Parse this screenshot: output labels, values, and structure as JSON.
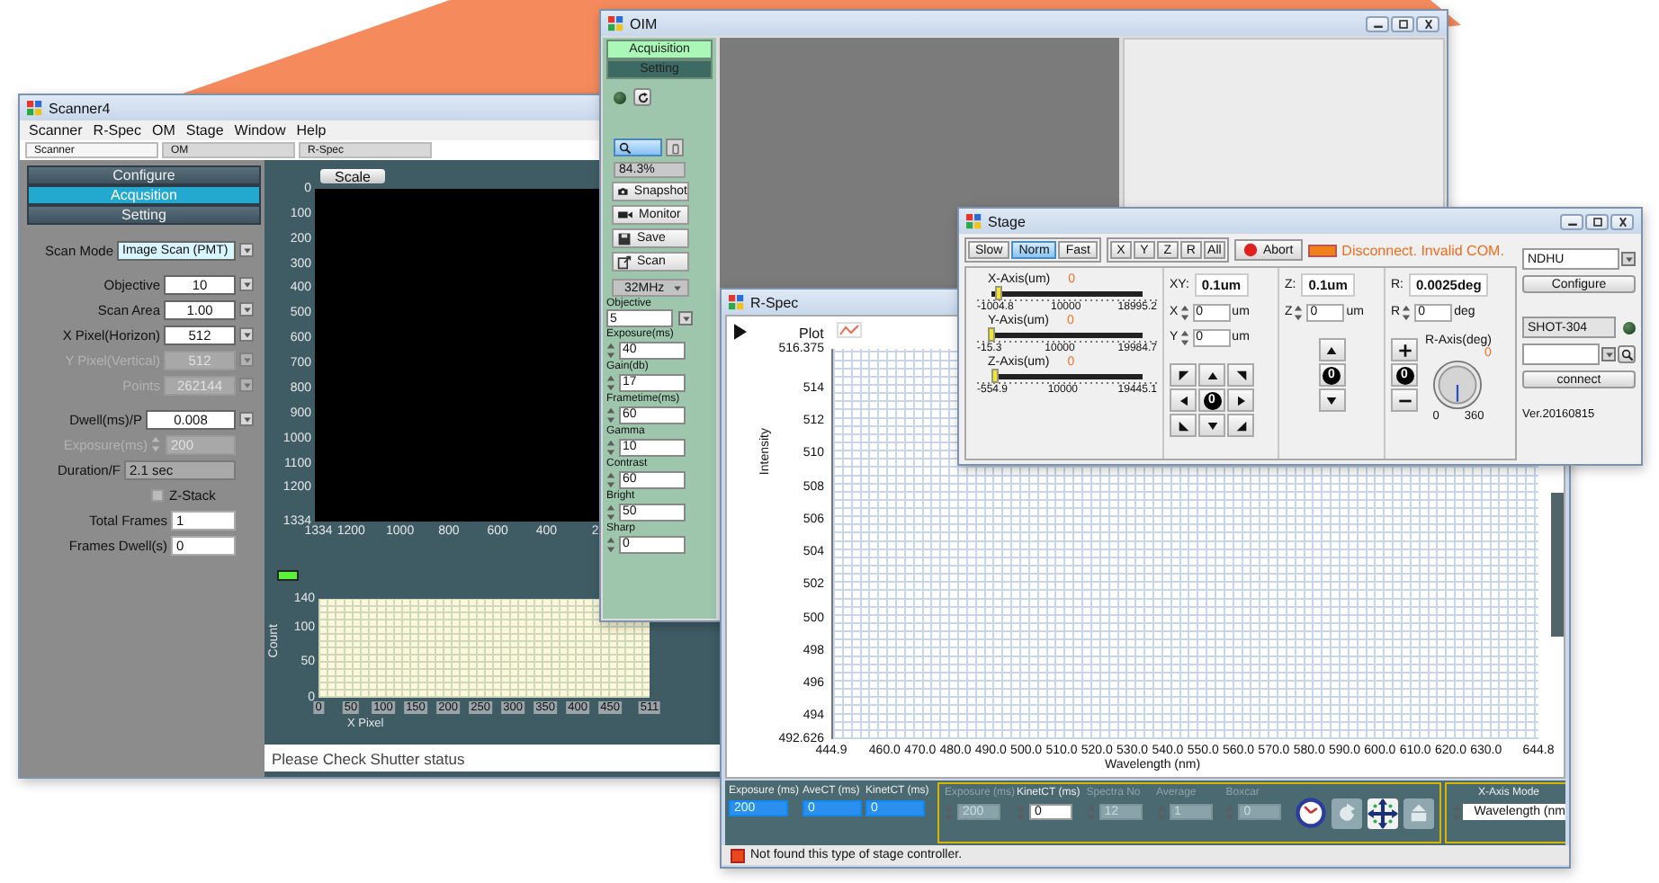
{
  "scanner": {
    "title": "Scanner4",
    "menu": [
      "Scanner",
      "R-Spec",
      "OM",
      "Stage",
      "Window",
      "Help"
    ],
    "tabs": [
      {
        "label": "Scanner",
        "selected": true
      },
      {
        "label": "OM",
        "selected": false
      },
      {
        "label": "R-Spec",
        "selected": false
      }
    ],
    "nav": [
      {
        "label": "Configure",
        "selected": false
      },
      {
        "label": "Acqusition",
        "selected": true
      },
      {
        "label": "Setting",
        "selected": false
      }
    ],
    "fields": [
      {
        "label": "Scan Mode",
        "value": "Image Scan (PMT)",
        "kind": "mode",
        "disabled": false
      },
      {
        "label": "Objective",
        "value": "10",
        "kind": "dropdown",
        "disabled": false
      },
      {
        "label": "Scan Area",
        "value": "1.00",
        "kind": "dropdown",
        "disabled": false
      },
      {
        "label": "X Pixel(Horizon)",
        "value": "512",
        "kind": "dropdown",
        "disabled": false
      },
      {
        "label": "Y Pixel(Vertical)",
        "value": "512",
        "kind": "dropdown",
        "disabled": true
      },
      {
        "label": "Points",
        "value": "262144",
        "kind": "dropdown",
        "disabled": true
      },
      {
        "label": "Dwell(ms)/P",
        "value": "0.008",
        "kind": "wide",
        "disabled": false
      },
      {
        "label": "Exposure(ms)",
        "value": "200",
        "kind": "spin",
        "disabled": true
      },
      {
        "label": "Duration/F",
        "value": "2.1 sec",
        "kind": "readout",
        "disabled": false
      }
    ],
    "z_stack": {
      "label": "Z-Stack",
      "checked": false
    },
    "frames": [
      {
        "label": "Total Frames",
        "value": "1"
      },
      {
        "label": "Frames Dwell(s)",
        "value": "0"
      }
    ],
    "scale_button": "Scale",
    "image": {
      "y_ticks": [
        "0",
        "100",
        "200",
        "300",
        "400",
        "500",
        "600",
        "700",
        "800",
        "900",
        "1000",
        "1100",
        "1200",
        "1334"
      ],
      "x_ticks": [
        "1334",
        "1200",
        "1000",
        "800",
        "600",
        "400",
        "2"
      ]
    },
    "led_on": true,
    "histogram": {
      "ylabel": "Count",
      "xlabel": "X Pixel",
      "y_ticks": [
        "140",
        "100",
        "50",
        "0"
      ],
      "x_ticks": [
        "0",
        "50",
        "100",
        "150",
        "200",
        "250",
        "300",
        "350",
        "400",
        "450",
        "511"
      ]
    },
    "status": "Please Check Shutter status"
  },
  "oim": {
    "title": "OIM",
    "nav": [
      {
        "label": "Acquisition",
        "selected": true
      },
      {
        "label": "Setting",
        "selected": false
      }
    ],
    "led_on": false,
    "tools": [
      {
        "kind": "zoom",
        "selected": true
      },
      {
        "kind": "pan",
        "selected": false
      }
    ],
    "zoom": "84.3%",
    "buttons": [
      {
        "kind": "snapshot",
        "label": "Snapshot"
      },
      {
        "kind": "monitor",
        "label": "Monitor"
      },
      {
        "kind": "save",
        "label": "Save"
      },
      {
        "kind": "scan",
        "label": "Scan"
      }
    ],
    "clock": "32MHz",
    "objective": {
      "label": "Objective",
      "value": "5"
    },
    "params": [
      {
        "label": "Exposure(ms)",
        "value": "40"
      },
      {
        "label": "Gain(db)",
        "value": "17"
      },
      {
        "label": "Frametime(ms)",
        "value": "60"
      },
      {
        "label": "Gamma",
        "value": "10"
      },
      {
        "label": "Contrast",
        "value": "60"
      },
      {
        "label": "Bright",
        "value": "50"
      },
      {
        "label": "Sharp",
        "value": "0"
      }
    ]
  },
  "rspec": {
    "title": "R-Spec",
    "legend": "Plot",
    "ylabel": "Intensity",
    "xlabel": "Wavelength (nm)",
    "y_ticks": [
      "516.375",
      "514",
      "512",
      "510",
      "508",
      "506",
      "504",
      "502",
      "500",
      "498",
      "496",
      "494",
      "492.626"
    ],
    "x_ticks": [
      "444.9",
      "460.0",
      "470.0",
      "480.0",
      "490.0",
      "500.0",
      "510.0",
      "520.0",
      "530.0",
      "540.0",
      "550.0",
      "560.0",
      "570.0",
      "580.0",
      "590.0",
      "600.0",
      "610.0",
      "620.0",
      "630.0",
      "644.8"
    ],
    "readouts": [
      {
        "label": "Exposure (ms)",
        "value": "200"
      },
      {
        "label": "AveCT (ms)",
        "value": "0"
      },
      {
        "label": "KinetCT (ms)",
        "value": "0"
      }
    ],
    "settings": [
      {
        "label": "Exposure (ms)",
        "value": "200",
        "disabled": true
      },
      {
        "label": "KinetCT (ms)",
        "value": "0",
        "disabled": false
      },
      {
        "label": "Spectra No",
        "value": "12",
        "disabled": true
      },
      {
        "label": "Average",
        "value": "1",
        "disabled": true
      },
      {
        "label": "Boxcar",
        "value": "0",
        "disabled": true
      }
    ],
    "tools": [
      {
        "kind": "clock",
        "disabled": false
      },
      {
        "kind": "refresh",
        "disabled": true
      },
      {
        "kind": "move",
        "disabled": false
      },
      {
        "kind": "export",
        "disabled": true
      }
    ],
    "x_axis_mode": {
      "label": "X-Axis Mode",
      "value": "Wavelength (nm"
    },
    "status": "Not found this type of stage controller."
  },
  "stage": {
    "title": "Stage",
    "speeds": [
      {
        "label": "Slow",
        "selected": false
      },
      {
        "label": "Norm",
        "selected": true
      },
      {
        "label": "Fast",
        "selected": false
      }
    ],
    "axes": [
      "X",
      "Y",
      "Z",
      "R",
      "All"
    ],
    "abort": "Abort",
    "connected": false,
    "message": "Disconnect. Invalid COM.",
    "sliders": [
      {
        "label": "X-Axis(um)",
        "value": "0",
        "level": 0.05,
        "min": "-1004.8",
        "mid": "10000",
        "max": "18995.2"
      },
      {
        "label": "Y-Axis(um)",
        "value": "0",
        "level": 0.001,
        "min": "-15.3",
        "mid": "10000",
        "max": "19984.7"
      },
      {
        "label": "Z-Axis(um)",
        "value": "0",
        "level": 0.028,
        "min": "-554.9",
        "mid": "10000",
        "max": "19445.1"
      }
    ],
    "xy": {
      "label": "XY:",
      "step": "0.1um",
      "spins": [
        {
          "label": "X",
          "value": "0",
          "unit": "um"
        },
        {
          "label": "Y",
          "value": "0",
          "unit": "um"
        }
      ],
      "center": "0"
    },
    "z": {
      "label": "Z:",
      "step": "0.1um",
      "spins": [
        {
          "label": "Z",
          "value": "0",
          "unit": "um"
        }
      ],
      "center": "0"
    },
    "r": {
      "label": "R:",
      "step": "0.0025deg",
      "spins": [
        {
          "label": "R",
          "value": "0",
          "unit": "deg"
        }
      ],
      "center": "0"
    },
    "knob": {
      "label": "R-Axis(deg)",
      "value": "0",
      "min": "0",
      "max": "360"
    },
    "site": "NDHU",
    "configure": "Configure",
    "controller": "SHOT-304",
    "controller_led_on": false,
    "connect": "connect",
    "version": "Ver.20160815"
  }
}
